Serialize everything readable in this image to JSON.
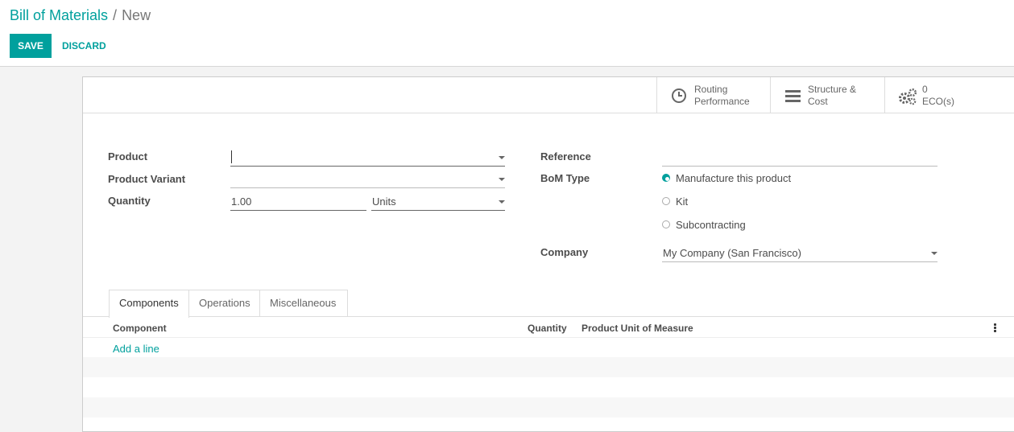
{
  "breadcrumb": {
    "parent": "Bill of Materials",
    "separator": "/",
    "current": "New"
  },
  "actions": {
    "save": "SAVE",
    "discard": "DISCARD"
  },
  "smart_buttons": {
    "routing": {
      "line1": "Routing",
      "line2": "Performance",
      "icon": "clock-icon"
    },
    "structure": {
      "line1": "Structure &",
      "line2": "Cost",
      "icon": "bars-icon"
    },
    "eco": {
      "line1": "0",
      "line2": "ECO(s)",
      "icon": "gears-icon"
    }
  },
  "form": {
    "product_label": "Product",
    "product_value": "",
    "variant_label": "Product Variant",
    "variant_value": "",
    "quantity_label": "Quantity",
    "quantity_value": "1.00",
    "uom_value": "Units",
    "reference_label": "Reference",
    "reference_value": "",
    "bom_type_label": "BoM Type",
    "bom_types": [
      "Manufacture this product",
      "Kit",
      "Subcontracting"
    ],
    "bom_type_selected": "Manufacture this product",
    "company_label": "Company",
    "company_value": "My Company (San Francisco)"
  },
  "tabs": [
    "Components",
    "Operations",
    "Miscellaneous"
  ],
  "active_tab": "Components",
  "table": {
    "columns": [
      "Component",
      "Quantity",
      "Product Unit of Measure"
    ],
    "add_line": "Add a line"
  },
  "colors": {
    "accent": "#00a09d",
    "text": "#4c4c4c",
    "background": "#f3f3f3"
  }
}
